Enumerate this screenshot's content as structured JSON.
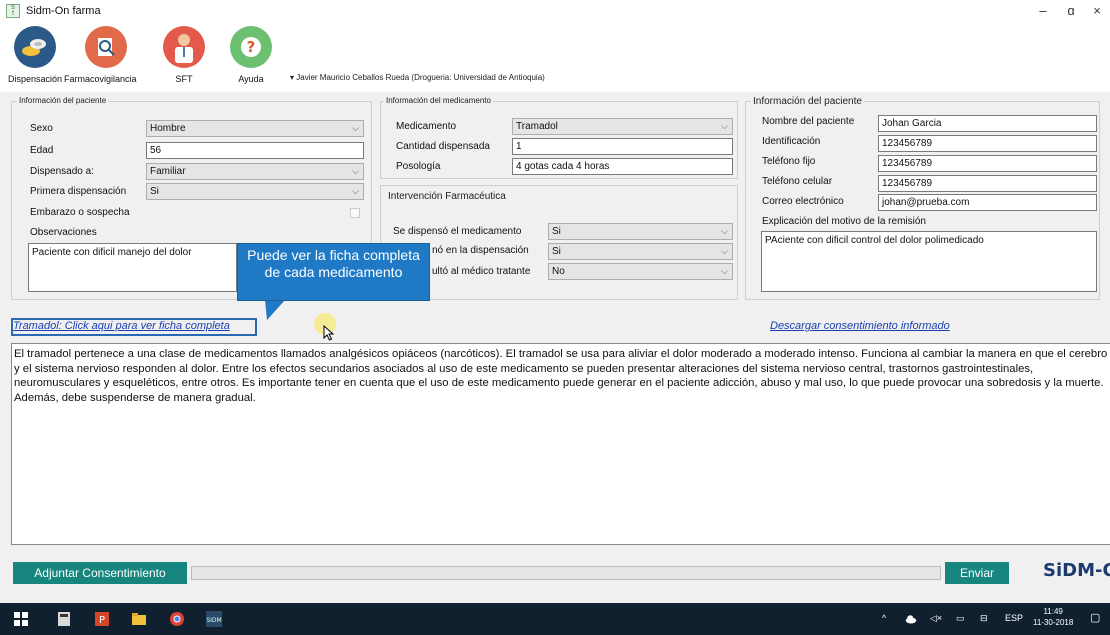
{
  "window": {
    "title": "Sidm-On farma",
    "app_icon_text": "SIDM farma",
    "controls": {
      "minimize": "–",
      "maximize": "ɑ",
      "close": "×"
    }
  },
  "toolbar": {
    "items": [
      {
        "label": "Dispensación",
        "icon": "pills-icon",
        "color": "#2b5a88"
      },
      {
        "label": "Farmacovigilancia",
        "icon": "search-report-icon",
        "color": "#e06a4a"
      },
      {
        "label": "SFT",
        "icon": "doctor-icon",
        "color": "#e45a4a"
      },
      {
        "label": "Ayuda",
        "icon": "question-icon",
        "color": "#6cc070"
      }
    ],
    "user_line": "▾ Javier Mauricio Ceballos Rueda (Drogueria: Universidad de Antioquia)"
  },
  "patient_left": {
    "group_title": "Información del paciente",
    "sexo_label": "Sexo",
    "sexo_value": "Hombre",
    "edad_label": "Edad",
    "edad_value": "56",
    "dispensado_label": "Dispensado a:",
    "dispensado_value": "Familiar",
    "primera_label": "Primera dispensación",
    "primera_value": "Si",
    "embarazo_label": "Embarazo o sospecha",
    "obs_label": "Observaciones",
    "obs_value": "Paciente con dificil manejo del dolor"
  },
  "medication": {
    "group_title": "Información del medicamento",
    "med_label": "Medicamento",
    "med_value": "Tramadol",
    "cant_label": "Cantidad dispensada",
    "cant_value": "1",
    "pos_label": "Posología",
    "pos_value": "4 gotas cada 4 horas"
  },
  "intervention": {
    "group_title": "Intervención Farmacéutica",
    "q1_label": "Se dispensó el medicamento",
    "q1_value": "Si",
    "q2_label": "nó en la dispensación",
    "q2_value": "Si",
    "q3_label": "ultó al médico tratante",
    "q3_value": "No"
  },
  "patient_right": {
    "group_title": "Información del paciente",
    "nombre_label": "Nombre del paciente",
    "nombre_value": "Johan Garcia",
    "id_label": "Identificación",
    "id_value": "123456789",
    "tel_label": "Teléfono fijo",
    "tel_value": "123456789",
    "cel_label": "Teléfono celular",
    "cel_value": "123456789",
    "correo_label": "Correo electrónico",
    "correo_value": "johan@prueba.com",
    "motivo_label": "Explicación del motivo de la remisión",
    "motivo_value": "PAciente con dificil control del dolor polimedicado"
  },
  "callout": {
    "text": "Puede ver la ficha completa de cada medicamento"
  },
  "links": {
    "ficha": "Tramadol: Click aqui para ver ficha completa",
    "consentimiento": "Descargar consentimiento informado"
  },
  "description": "El tramadol pertenece a una clase de medicamentos llamados analgésicos opiáceos (narcóticos). El tramadol se usa para aliviar el dolor moderado a moderado intenso. Funciona al cambiar la manera en que el cerebro y el sistema nervioso responden al dolor. Entre los efectos secundarios asociados al uso de este medicamento se pueden presentar alteraciones del sistema nervioso central, trastornos gastrointestinales, neuromusculares y esqueléticos, entre otros. Es importante tener en cuenta que el uso de este medicamento puede generar en el paciente adicción, abuso y mal uso, lo que puede provocar una sobredosis y la muerte. Además, debe suspenderse de manera gradual.",
  "bottom": {
    "adjuntar": "Adjuntar Consentimiento",
    "enviar": "Enviar",
    "logo": "SiDM-O"
  },
  "taskbar": {
    "lang": "ESP",
    "time": "11:49",
    "date": "11-30-2018"
  },
  "colors": {
    "accent": "#17867e",
    "callout": "#1f79c4",
    "link": "#1a3fb0"
  }
}
